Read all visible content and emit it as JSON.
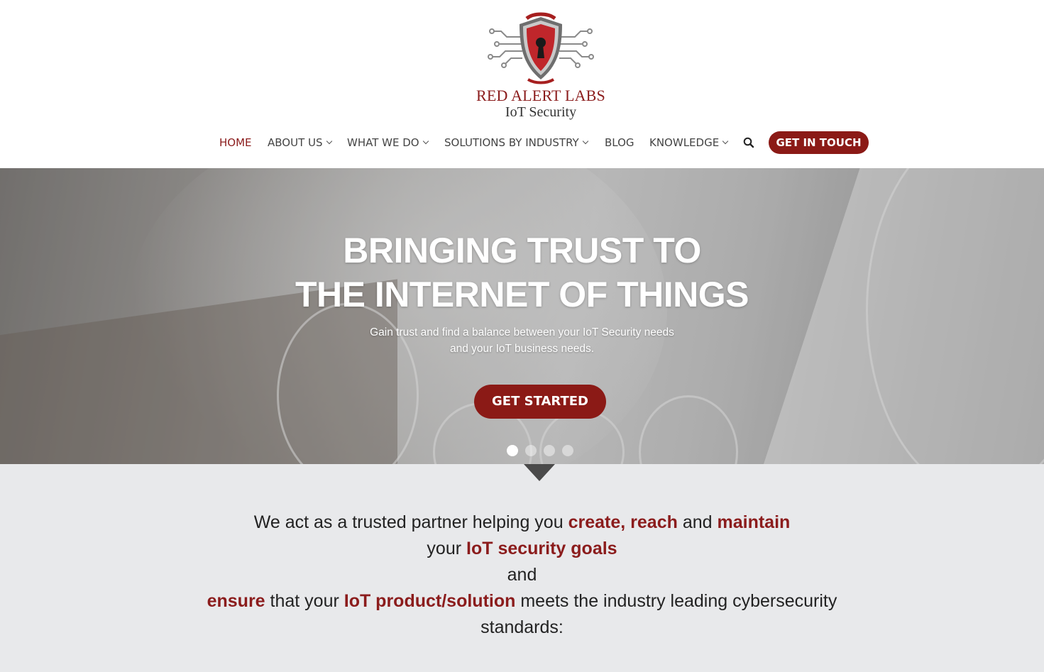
{
  "brand": {
    "name": "RED ALERT LABS",
    "tagline": "IoT Security"
  },
  "nav": {
    "items": [
      {
        "label": "HOME",
        "active": true,
        "has_dropdown": false
      },
      {
        "label": "ABOUT US",
        "active": false,
        "has_dropdown": true
      },
      {
        "label": "WHAT WE DO",
        "active": false,
        "has_dropdown": true
      },
      {
        "label": "SOLUTIONS BY INDUSTRY",
        "active": false,
        "has_dropdown": true
      },
      {
        "label": "BLOG",
        "active": false,
        "has_dropdown": false
      },
      {
        "label": "KNOWLEDGE",
        "active": false,
        "has_dropdown": true
      }
    ],
    "search_icon": "search-icon",
    "cta_label": "GET IN TOUCH"
  },
  "hero": {
    "title_line1": "BRINGING TRUST TO",
    "title_line2": "THE INTERNET OF THINGS",
    "subtitle_line1": "Gain trust and find a balance between your IoT Security needs",
    "subtitle_line2": "and your IoT business needs.",
    "cta_label": "GET STARTED",
    "slides_count": 4,
    "active_slide": 1
  },
  "intro": {
    "l1_a": "We act as a trusted partner helping you ",
    "l1_create": "create",
    "l1_comma": ", ",
    "l1_reach": "reach",
    "l1_and": " and ",
    "l1_maintain": "maintain",
    "l2_your": "your ",
    "l2_goals": "IoT security goals",
    "l3_and": "and",
    "l4_ensure": "ensure",
    "l4_that": " that your ",
    "l4_product": "IoT product/solution",
    "l4_rest": " meets the industry leading cybersecurity",
    "l5": "standards:"
  },
  "colors": {
    "brand_red": "#8b1a16",
    "intro_bg": "#e8e9eb"
  }
}
